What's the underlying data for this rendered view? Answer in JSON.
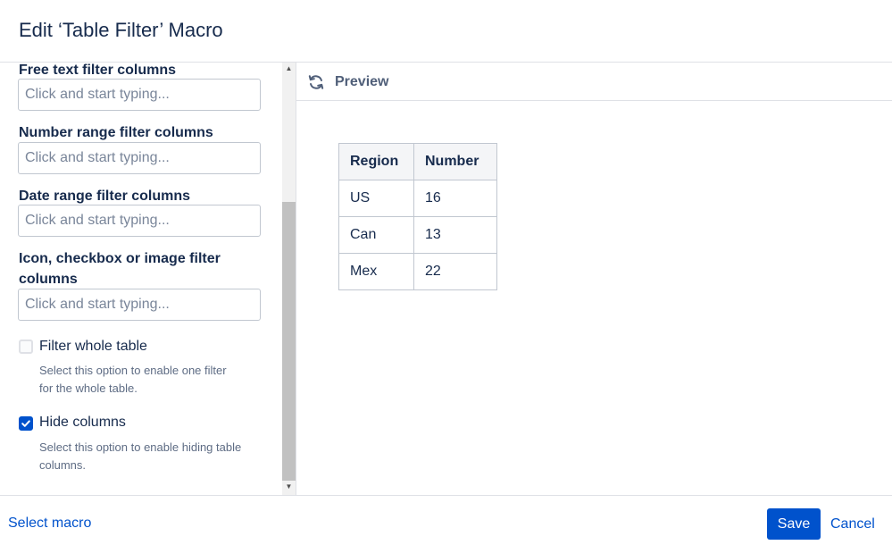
{
  "dialog": {
    "title": "Edit ‘Table Filter’ Macro"
  },
  "form": {
    "free_text": {
      "label": "Free text filter columns",
      "placeholder": "Click and start typing..."
    },
    "number_range": {
      "label": "Number range filter columns",
      "placeholder": "Click and start typing..."
    },
    "date_range": {
      "label": "Date range filter columns",
      "placeholder": "Click and start typing..."
    },
    "icon_filter": {
      "label_line1": "Icon, checkbox or image filter",
      "label_line2": "columns",
      "placeholder": "Click and start typing..."
    },
    "filter_whole_table": {
      "label": "Filter whole table",
      "checked": false,
      "desc_line1": "Select this option to enable one filter",
      "desc_line2": "for the whole table."
    },
    "hide_columns": {
      "label": "Hide columns",
      "checked": true,
      "desc_line1": "Select this option to enable hiding table",
      "desc_line2": "columns."
    }
  },
  "preview": {
    "label": "Preview",
    "icon": "refresh-icon",
    "table": {
      "headers": [
        "Region",
        "Number"
      ],
      "rows": [
        [
          "US",
          "16"
        ],
        [
          "Can",
          "13"
        ],
        [
          "Mex",
          "22"
        ]
      ]
    }
  },
  "footer": {
    "select_macro": "Select macro",
    "save": "Save",
    "cancel": "Cancel"
  },
  "colors": {
    "primary": "#0052cc",
    "text": "#172b4d",
    "border": "#dfe1e6"
  }
}
